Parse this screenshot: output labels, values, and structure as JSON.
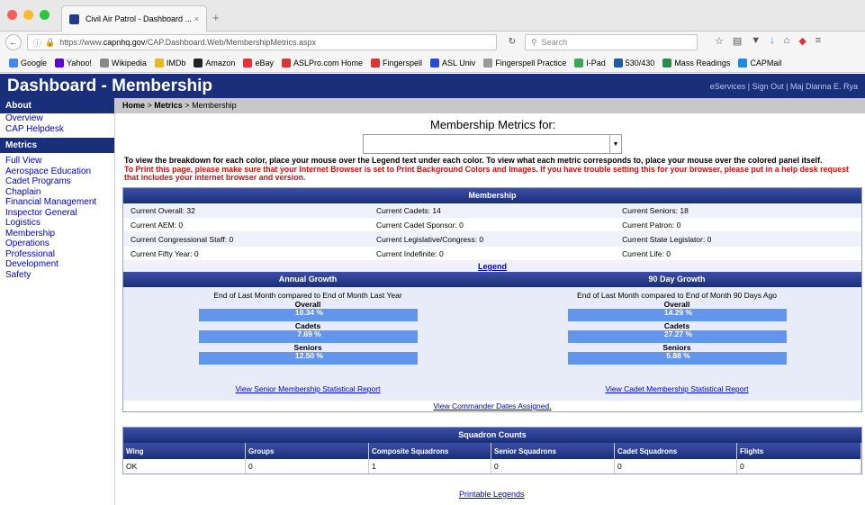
{
  "browser": {
    "tab_title": "Civil Air Patrol - Dashboard ...",
    "tab_close": "×",
    "new_tab": "+",
    "url_prefix": "https://www.",
    "url_domain": "capnhq.gov",
    "url_path": "/CAP.Dashboard.Web/MembershipMetrics.aspx",
    "search_placeholder": "Search",
    "bookmarks": [
      {
        "label": "Google",
        "color": "#4285f4"
      },
      {
        "label": "Yahoo!",
        "color": "#6001d2"
      },
      {
        "label": "Wikipedia",
        "color": "#888888"
      },
      {
        "label": "IMDb",
        "color": "#e6b91e"
      },
      {
        "label": "Amazon",
        "color": "#222222"
      },
      {
        "label": "eBay",
        "color": "#e53238"
      },
      {
        "label": "ASLPro.com Home",
        "color": "#d33"
      },
      {
        "label": "Fingerspell",
        "color": "#d33"
      },
      {
        "label": "ASL Univ",
        "color": "#2a4bd7"
      },
      {
        "label": "Fingerspell Practice",
        "color": "#999999"
      },
      {
        "label": "I-Pad",
        "color": "#3aa757"
      },
      {
        "label": "530/430",
        "color": "#1e5ca8"
      },
      {
        "label": "Mass Readings",
        "color": "#2a8a4a"
      },
      {
        "label": "CAPMail",
        "color": "#1e88e5"
      }
    ]
  },
  "header": {
    "title": "Dashboard - Membership",
    "links": "eServices | Sign Out | Maj Dianna E. Rya"
  },
  "sidebar": {
    "about_heading": "About",
    "about_items": [
      "Overview",
      "CAP Helpdesk"
    ],
    "metrics_heading": "Metrics",
    "metrics_items": [
      "Full View",
      "Aerospace Education",
      "Cadet Programs",
      "Chaplain",
      "Financial Management",
      "Inspector General",
      "Logistics",
      "Membership",
      "Operations",
      "Professional Development",
      "Safety"
    ]
  },
  "breadcrumb": {
    "home": "Home",
    "sep1": " > ",
    "metrics": "Metrics",
    "sep2": " > ",
    "current": "Membership"
  },
  "main": {
    "metrics_for": "Membership Metrics for:",
    "instructions": "To view the breakdown for each color, place your mouse over the Legend text under each color. To view what each metric corresponds to, place your mouse over the colored panel itself.",
    "print_warning": "To Print this page, please make sure that your Internet Browser is set to Print Background Colors and Images. If you have trouble setting this for your browser, please put in a help desk request that includes your internet browser and version.",
    "membership_heading": "Membership",
    "metrics_rows": [
      [
        "Current Overall: 32",
        "Current Cadets: 14",
        "Current Seniors: 18"
      ],
      [
        "Current AEM: 0",
        "Current Cadet Sponsor: 0",
        "Current Patron: 0"
      ],
      [
        "Current Congressional Staff: 0",
        "Current Legislative/Congress: 0",
        "Current State Legislator: 0"
      ],
      [
        "Current Fifty Year: 0",
        "Current Indefinite: 0",
        "Current Life: 0"
      ]
    ],
    "legend": "Legend",
    "annual": {
      "heading": "Annual Growth",
      "caption": "End of Last Month compared to End of Month Last Year",
      "items": [
        {
          "label": "Overall",
          "value": "10.34 %"
        },
        {
          "label": "Cadets",
          "value": "7.69 %"
        },
        {
          "label": "Seniors",
          "value": "12.50 %"
        }
      ],
      "report_link": "View Senior Membership Statistical Report"
    },
    "ninety": {
      "heading": "90 Day Growth",
      "caption": "End of Last Month compared to End of Month 90 Days Ago",
      "items": [
        {
          "label": "Overall",
          "value": "14.29 %"
        },
        {
          "label": "Cadets",
          "value": "27.27 %"
        },
        {
          "label": "Seniors",
          "value": "5.88 %"
        }
      ],
      "report_link": "View Cadet Membership Statistical Report"
    },
    "commander_link": "View Commander Dates Assigned.",
    "squadron": {
      "heading": "Squadron Counts",
      "columns": [
        "Wing",
        "Groups",
        "Composite Squadrons",
        "Senior Squadrons",
        "Cadet Squadrons",
        "Flights"
      ],
      "row": [
        "OK",
        "0",
        "1",
        "0",
        "0",
        "0"
      ]
    },
    "printable_legends": "Printable Legends"
  }
}
